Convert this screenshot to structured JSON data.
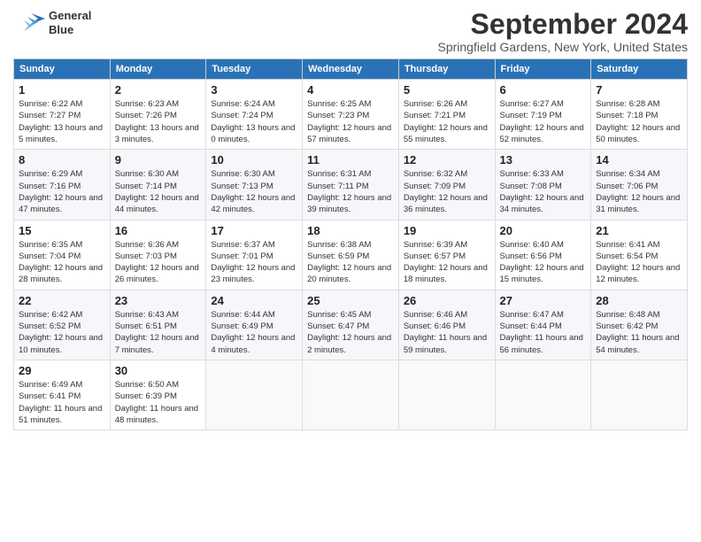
{
  "header": {
    "logo_line1": "General",
    "logo_line2": "Blue",
    "month_title": "September 2024",
    "subtitle": "Springfield Gardens, New York, United States"
  },
  "weekdays": [
    "Sunday",
    "Monday",
    "Tuesday",
    "Wednesday",
    "Thursday",
    "Friday",
    "Saturday"
  ],
  "weeks": [
    [
      {
        "day": "1",
        "info": "Sunrise: 6:22 AM\nSunset: 7:27 PM\nDaylight: 13 hours and 5 minutes."
      },
      {
        "day": "2",
        "info": "Sunrise: 6:23 AM\nSunset: 7:26 PM\nDaylight: 13 hours and 3 minutes."
      },
      {
        "day": "3",
        "info": "Sunrise: 6:24 AM\nSunset: 7:24 PM\nDaylight: 13 hours and 0 minutes."
      },
      {
        "day": "4",
        "info": "Sunrise: 6:25 AM\nSunset: 7:23 PM\nDaylight: 12 hours and 57 minutes."
      },
      {
        "day": "5",
        "info": "Sunrise: 6:26 AM\nSunset: 7:21 PM\nDaylight: 12 hours and 55 minutes."
      },
      {
        "day": "6",
        "info": "Sunrise: 6:27 AM\nSunset: 7:19 PM\nDaylight: 12 hours and 52 minutes."
      },
      {
        "day": "7",
        "info": "Sunrise: 6:28 AM\nSunset: 7:18 PM\nDaylight: 12 hours and 50 minutes."
      }
    ],
    [
      {
        "day": "8",
        "info": "Sunrise: 6:29 AM\nSunset: 7:16 PM\nDaylight: 12 hours and 47 minutes."
      },
      {
        "day": "9",
        "info": "Sunrise: 6:30 AM\nSunset: 7:14 PM\nDaylight: 12 hours and 44 minutes."
      },
      {
        "day": "10",
        "info": "Sunrise: 6:30 AM\nSunset: 7:13 PM\nDaylight: 12 hours and 42 minutes."
      },
      {
        "day": "11",
        "info": "Sunrise: 6:31 AM\nSunset: 7:11 PM\nDaylight: 12 hours and 39 minutes."
      },
      {
        "day": "12",
        "info": "Sunrise: 6:32 AM\nSunset: 7:09 PM\nDaylight: 12 hours and 36 minutes."
      },
      {
        "day": "13",
        "info": "Sunrise: 6:33 AM\nSunset: 7:08 PM\nDaylight: 12 hours and 34 minutes."
      },
      {
        "day": "14",
        "info": "Sunrise: 6:34 AM\nSunset: 7:06 PM\nDaylight: 12 hours and 31 minutes."
      }
    ],
    [
      {
        "day": "15",
        "info": "Sunrise: 6:35 AM\nSunset: 7:04 PM\nDaylight: 12 hours and 28 minutes."
      },
      {
        "day": "16",
        "info": "Sunrise: 6:36 AM\nSunset: 7:03 PM\nDaylight: 12 hours and 26 minutes."
      },
      {
        "day": "17",
        "info": "Sunrise: 6:37 AM\nSunset: 7:01 PM\nDaylight: 12 hours and 23 minutes."
      },
      {
        "day": "18",
        "info": "Sunrise: 6:38 AM\nSunset: 6:59 PM\nDaylight: 12 hours and 20 minutes."
      },
      {
        "day": "19",
        "info": "Sunrise: 6:39 AM\nSunset: 6:57 PM\nDaylight: 12 hours and 18 minutes."
      },
      {
        "day": "20",
        "info": "Sunrise: 6:40 AM\nSunset: 6:56 PM\nDaylight: 12 hours and 15 minutes."
      },
      {
        "day": "21",
        "info": "Sunrise: 6:41 AM\nSunset: 6:54 PM\nDaylight: 12 hours and 12 minutes."
      }
    ],
    [
      {
        "day": "22",
        "info": "Sunrise: 6:42 AM\nSunset: 6:52 PM\nDaylight: 12 hours and 10 minutes."
      },
      {
        "day": "23",
        "info": "Sunrise: 6:43 AM\nSunset: 6:51 PM\nDaylight: 12 hours and 7 minutes."
      },
      {
        "day": "24",
        "info": "Sunrise: 6:44 AM\nSunset: 6:49 PM\nDaylight: 12 hours and 4 minutes."
      },
      {
        "day": "25",
        "info": "Sunrise: 6:45 AM\nSunset: 6:47 PM\nDaylight: 12 hours and 2 minutes."
      },
      {
        "day": "26",
        "info": "Sunrise: 6:46 AM\nSunset: 6:46 PM\nDaylight: 11 hours and 59 minutes."
      },
      {
        "day": "27",
        "info": "Sunrise: 6:47 AM\nSunset: 6:44 PM\nDaylight: 11 hours and 56 minutes."
      },
      {
        "day": "28",
        "info": "Sunrise: 6:48 AM\nSunset: 6:42 PM\nDaylight: 11 hours and 54 minutes."
      }
    ],
    [
      {
        "day": "29",
        "info": "Sunrise: 6:49 AM\nSunset: 6:41 PM\nDaylight: 11 hours and 51 minutes."
      },
      {
        "day": "30",
        "info": "Sunrise: 6:50 AM\nSunset: 6:39 PM\nDaylight: 11 hours and 48 minutes."
      },
      {
        "day": "",
        "info": ""
      },
      {
        "day": "",
        "info": ""
      },
      {
        "day": "",
        "info": ""
      },
      {
        "day": "",
        "info": ""
      },
      {
        "day": "",
        "info": ""
      }
    ]
  ]
}
